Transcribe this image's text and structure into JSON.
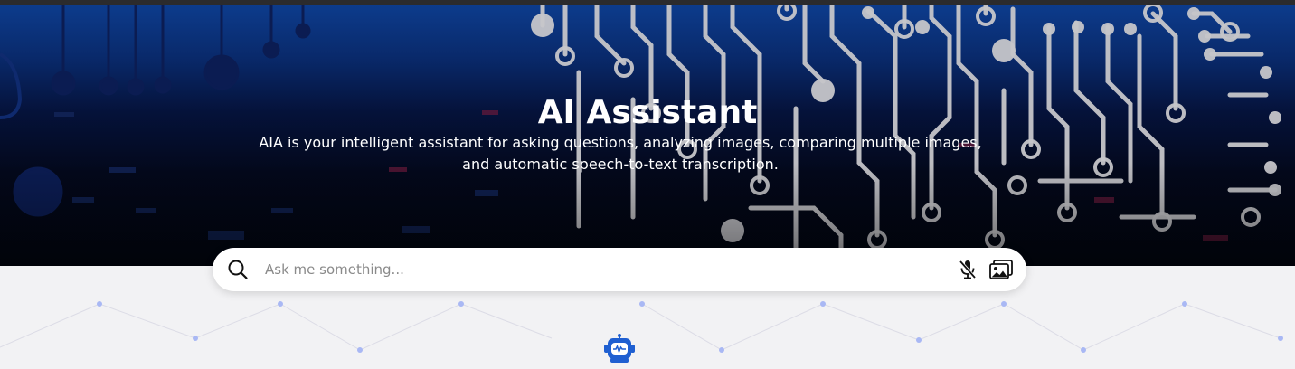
{
  "hero": {
    "title": "AI Assistant",
    "description_line1": "AIA is your intelligent assistant for asking questions, analyzing images, comparing multiple images,",
    "description_line2": "and automatic speech-to-text transcription."
  },
  "search": {
    "placeholder": "Ask me something...",
    "value": ""
  },
  "icons": {
    "search": "search-icon",
    "mic": "microphone-muted-icon",
    "image": "image-upload-icon",
    "bot": "robot-icon"
  },
  "colors": {
    "hero_top": "#0d3d8f",
    "hero_bottom": "#020611",
    "circuit": "#c9c9cc",
    "bot_accent": "#1f5fd1",
    "background": "#f2f2f4"
  }
}
